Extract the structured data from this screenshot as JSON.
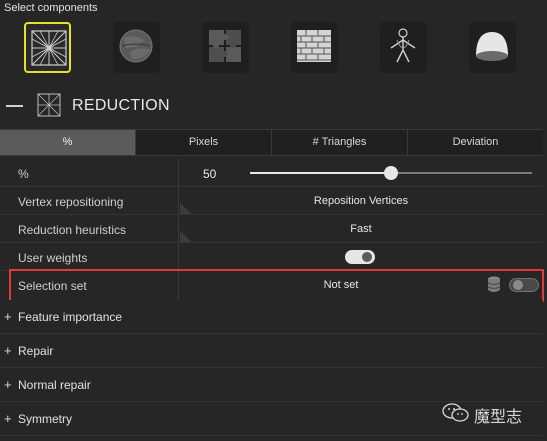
{
  "components": {
    "label": "Select components",
    "items": [
      {
        "icon": "wireframe-mesh-icon",
        "selected": true
      },
      {
        "icon": "textured-sphere-icon",
        "selected": false
      },
      {
        "icon": "puzzle-uv-icon",
        "selected": false
      },
      {
        "icon": "brick-wall-icon",
        "selected": false
      },
      {
        "icon": "skeleton-rig-icon",
        "selected": false
      },
      {
        "icon": "half-dome-icon",
        "selected": false
      }
    ]
  },
  "section": {
    "title": "REDUCTION"
  },
  "tabs": [
    "%",
    "Pixels",
    "# Triangles",
    "Deviation"
  ],
  "rows": {
    "percent": {
      "label": "%",
      "value": "50",
      "slider_fraction": 0.5
    },
    "vertex": {
      "label": "Vertex repositioning",
      "value": "Reposition Vertices"
    },
    "heuristics": {
      "label": "Reduction heuristics",
      "value": "Fast"
    },
    "weights": {
      "label": "User weights",
      "enabled": true
    },
    "selection": {
      "label": "Selection set",
      "value": "Not set",
      "enabled": false
    }
  },
  "collapsed_sections": [
    "Feature importance",
    "Repair",
    "Normal repair",
    "Symmetry"
  ],
  "colors": {
    "accent_highlight": "#e23a3a",
    "selected_component": "#e6e22a"
  },
  "watermark": {
    "text": "魔型志"
  }
}
